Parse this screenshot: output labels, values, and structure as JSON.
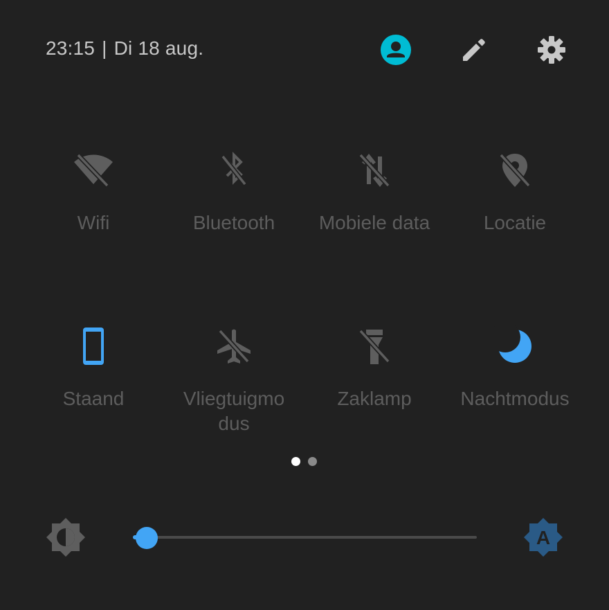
{
  "header": {
    "time": "23:15",
    "separator": "|",
    "date": "Di 18 aug.",
    "icons": [
      "account-icon",
      "edit-pencil-icon",
      "settings-gear-icon"
    ]
  },
  "tiles": [
    {
      "label": "Wifi",
      "icon": "wifi-off-icon",
      "active": false
    },
    {
      "label": "Bluetooth",
      "icon": "bluetooth-off-icon",
      "active": false
    },
    {
      "label": "Mobiele data",
      "icon": "mobile-data-off-icon",
      "active": false
    },
    {
      "label": "Locatie",
      "icon": "location-off-icon",
      "active": false
    },
    {
      "label": "Staand",
      "icon": "portrait-phone-icon",
      "active": true
    },
    {
      "label": "Vliegtuigmo\ndus",
      "icon": "airplane-off-icon",
      "active": false
    },
    {
      "label": "Zaklamp",
      "icon": "flashlight-off-icon",
      "active": false
    },
    {
      "label": "Nachtmodus",
      "icon": "night-mode-moon-icon",
      "active": true
    }
  ],
  "pager": {
    "count": 2,
    "current": 1
  },
  "brightness": {
    "level": 0.04,
    "left_icon": "brightness-icon",
    "right_icon": "auto-brightness-icon",
    "auto_label": "A"
  },
  "colors": {
    "background": "#212121",
    "accent": "#42a5f5",
    "accent_text": "#4aa3f0",
    "account_accent": "#00bcd4",
    "inactive_icon": "#5e5e5e",
    "inactive_text": "#5d5d5d",
    "header_icon": "#c8c8c8",
    "dot_active": "#ffffff",
    "dot_inactive": "#8a8a8a"
  }
}
